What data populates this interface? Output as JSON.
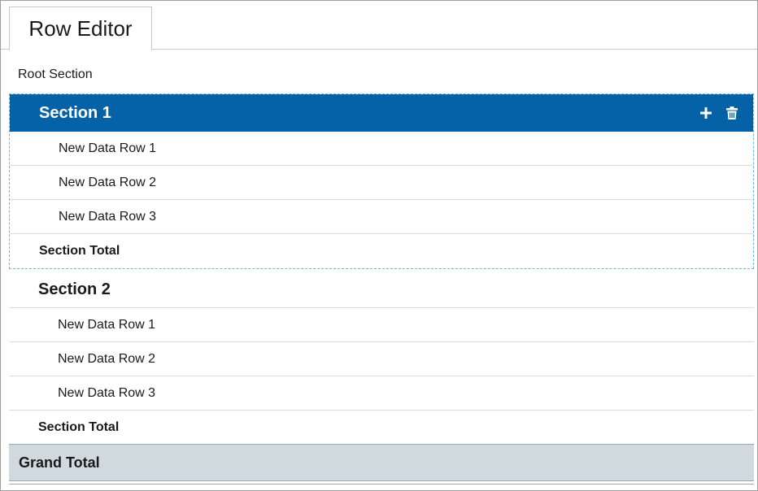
{
  "tabs": [
    {
      "label": "Row Editor",
      "active": true
    }
  ],
  "root_label": "Root Section",
  "colors": {
    "selected_header_bg": "#0562a7",
    "grand_total_bg": "#d0d9de",
    "selection_outline": "#6fb7d6"
  },
  "sections": [
    {
      "title": "Section 1",
      "selected": true,
      "actions": [
        {
          "icon": "plus-icon",
          "meaning": "add"
        },
        {
          "icon": "trash-icon",
          "meaning": "delete"
        }
      ],
      "rows": [
        "New Data Row 1",
        "New Data Row 2",
        "New Data Row 3"
      ],
      "total_label": "Section Total"
    },
    {
      "title": "Section 2",
      "selected": false,
      "rows": [
        "New Data Row 1",
        "New Data Row 2",
        "New Data Row 3"
      ],
      "total_label": "Section Total"
    }
  ],
  "grand_total_label": "Grand Total"
}
